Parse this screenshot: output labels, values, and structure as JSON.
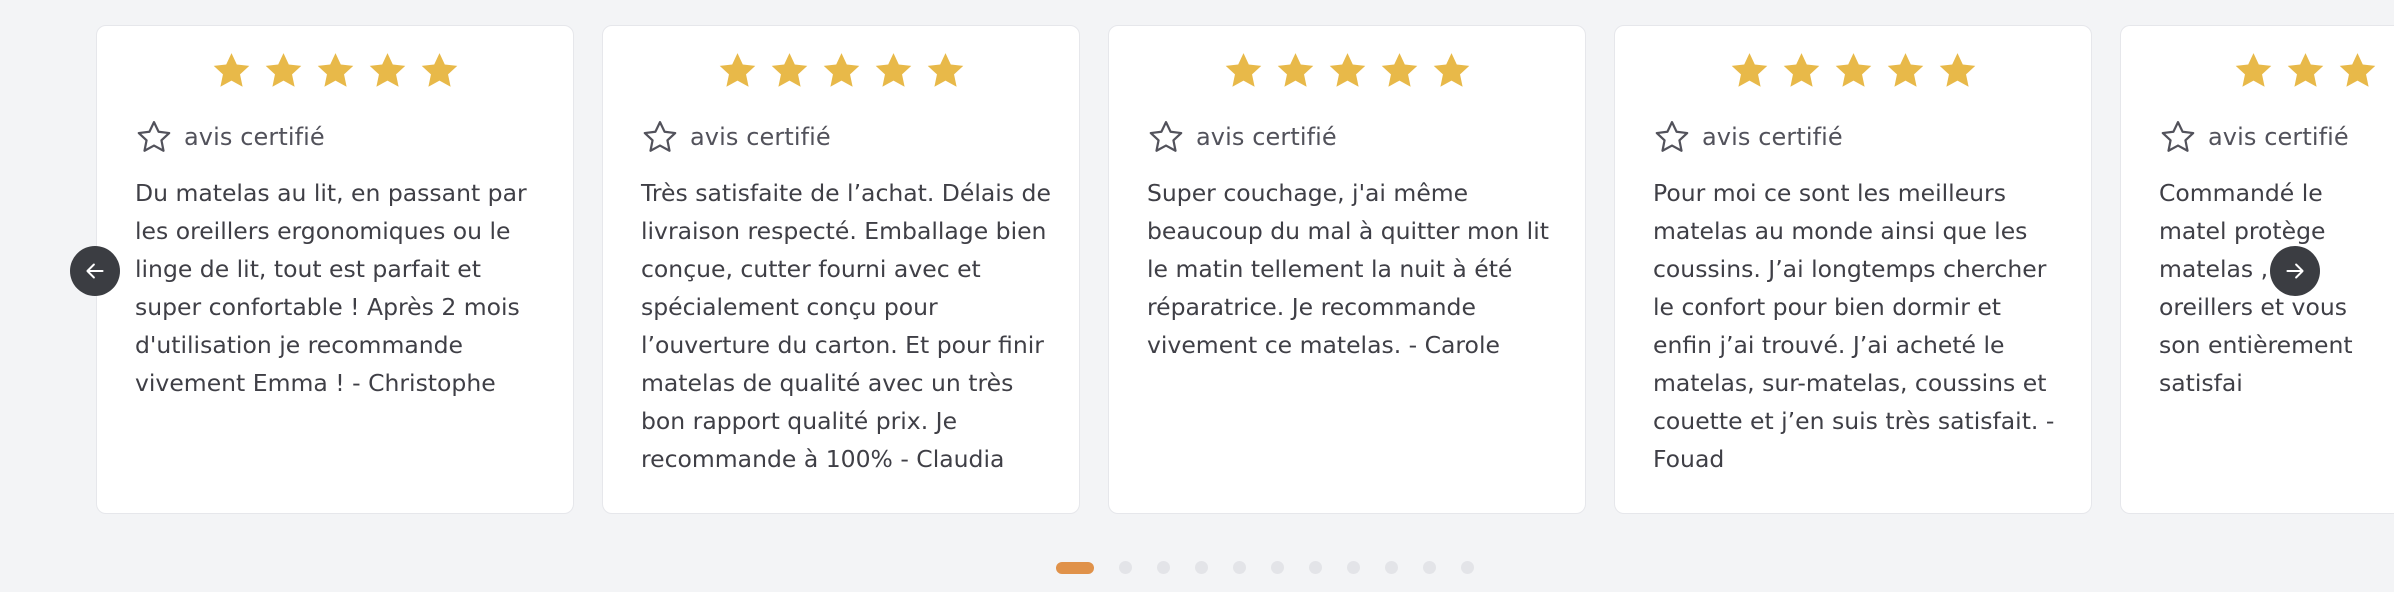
{
  "colors": {
    "star": "#e8b949",
    "accent_dot": "#e0924a",
    "nav_button": "#3b3d42"
  },
  "rating": {
    "value": 5,
    "max": 5
  },
  "carousel": {
    "prev_icon": "arrow-left-icon",
    "next_icon": "arrow-right-icon",
    "cards": [
      {
        "certified_label": "avis certifié",
        "review": "Du matelas au lit, en passant par les oreillers ergonomiques ou le linge de lit, tout est parfait et super confortable ! Après 2 mois d'utilisation je recommande vivement Emma ! - Christophe"
      },
      {
        "certified_label": "avis certifié",
        "review": "Très satisfaite de l’achat. Délais de livraison respecté. Emballage bien conçue, cutter fourni avec et spécialement conçu pour l’ouverture du carton. Et pour finir matelas de qualité avec un très bon rapport qualité prix. Je recommande à 100% - Claudia"
      },
      {
        "certified_label": "avis certifié",
        "review": "Super couchage, j'ai même beaucoup du mal à quitter mon lit le matin tellement la nuit à été réparatrice. Je recommande vivement ce matelas. - Carole"
      },
      {
        "certified_label": "avis certifié",
        "review": "Pour moi ce sont les meilleurs matelas au monde ainsi que les coussins. J’ai longtemps chercher le confort pour bien dormir et enfin j’ai trouvé. J’ai acheté le matelas, sur-matelas, coussins et couette et j’en suis très satisfait. - Fouad"
      },
      {
        "certified_label": "avis certifié",
        "review": "Commandé le matel protège matelas , La oreillers et vous son entièrement satisfai"
      }
    ],
    "pagination": {
      "total": 11,
      "active": 1
    }
  }
}
